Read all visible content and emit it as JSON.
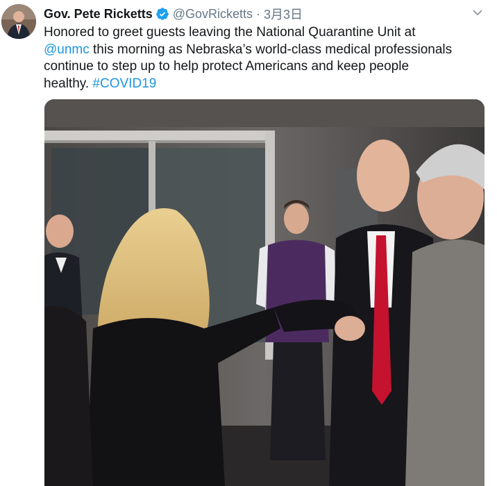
{
  "tweet": {
    "author": {
      "display_name": "Gov. Pete Ricketts",
      "handle": "@GovRicketts",
      "verified": true,
      "avatar_icon": "profile-photo"
    },
    "separator": "·",
    "date": "3月3日",
    "menu_icon": "chevron-down-icon",
    "text": {
      "line_1": "Honored to greet guests leaving the National Quarantine Unit at",
      "mention": "@unmc",
      "line_2_rest": " this morning as Nebraska’s world-class medical professionals",
      "line_3": "continue to step up to help protect Americans and keep people",
      "line_4_start": "healthy. ",
      "hashtag": "#COVID19"
    },
    "media": {
      "kind": "video-still",
      "description_icon": "video-thumbnail"
    }
  },
  "colors": {
    "text": "#14171a",
    "secondary": "#657786",
    "link": "#1b95e0",
    "verified_badge": "#1da1f2"
  }
}
